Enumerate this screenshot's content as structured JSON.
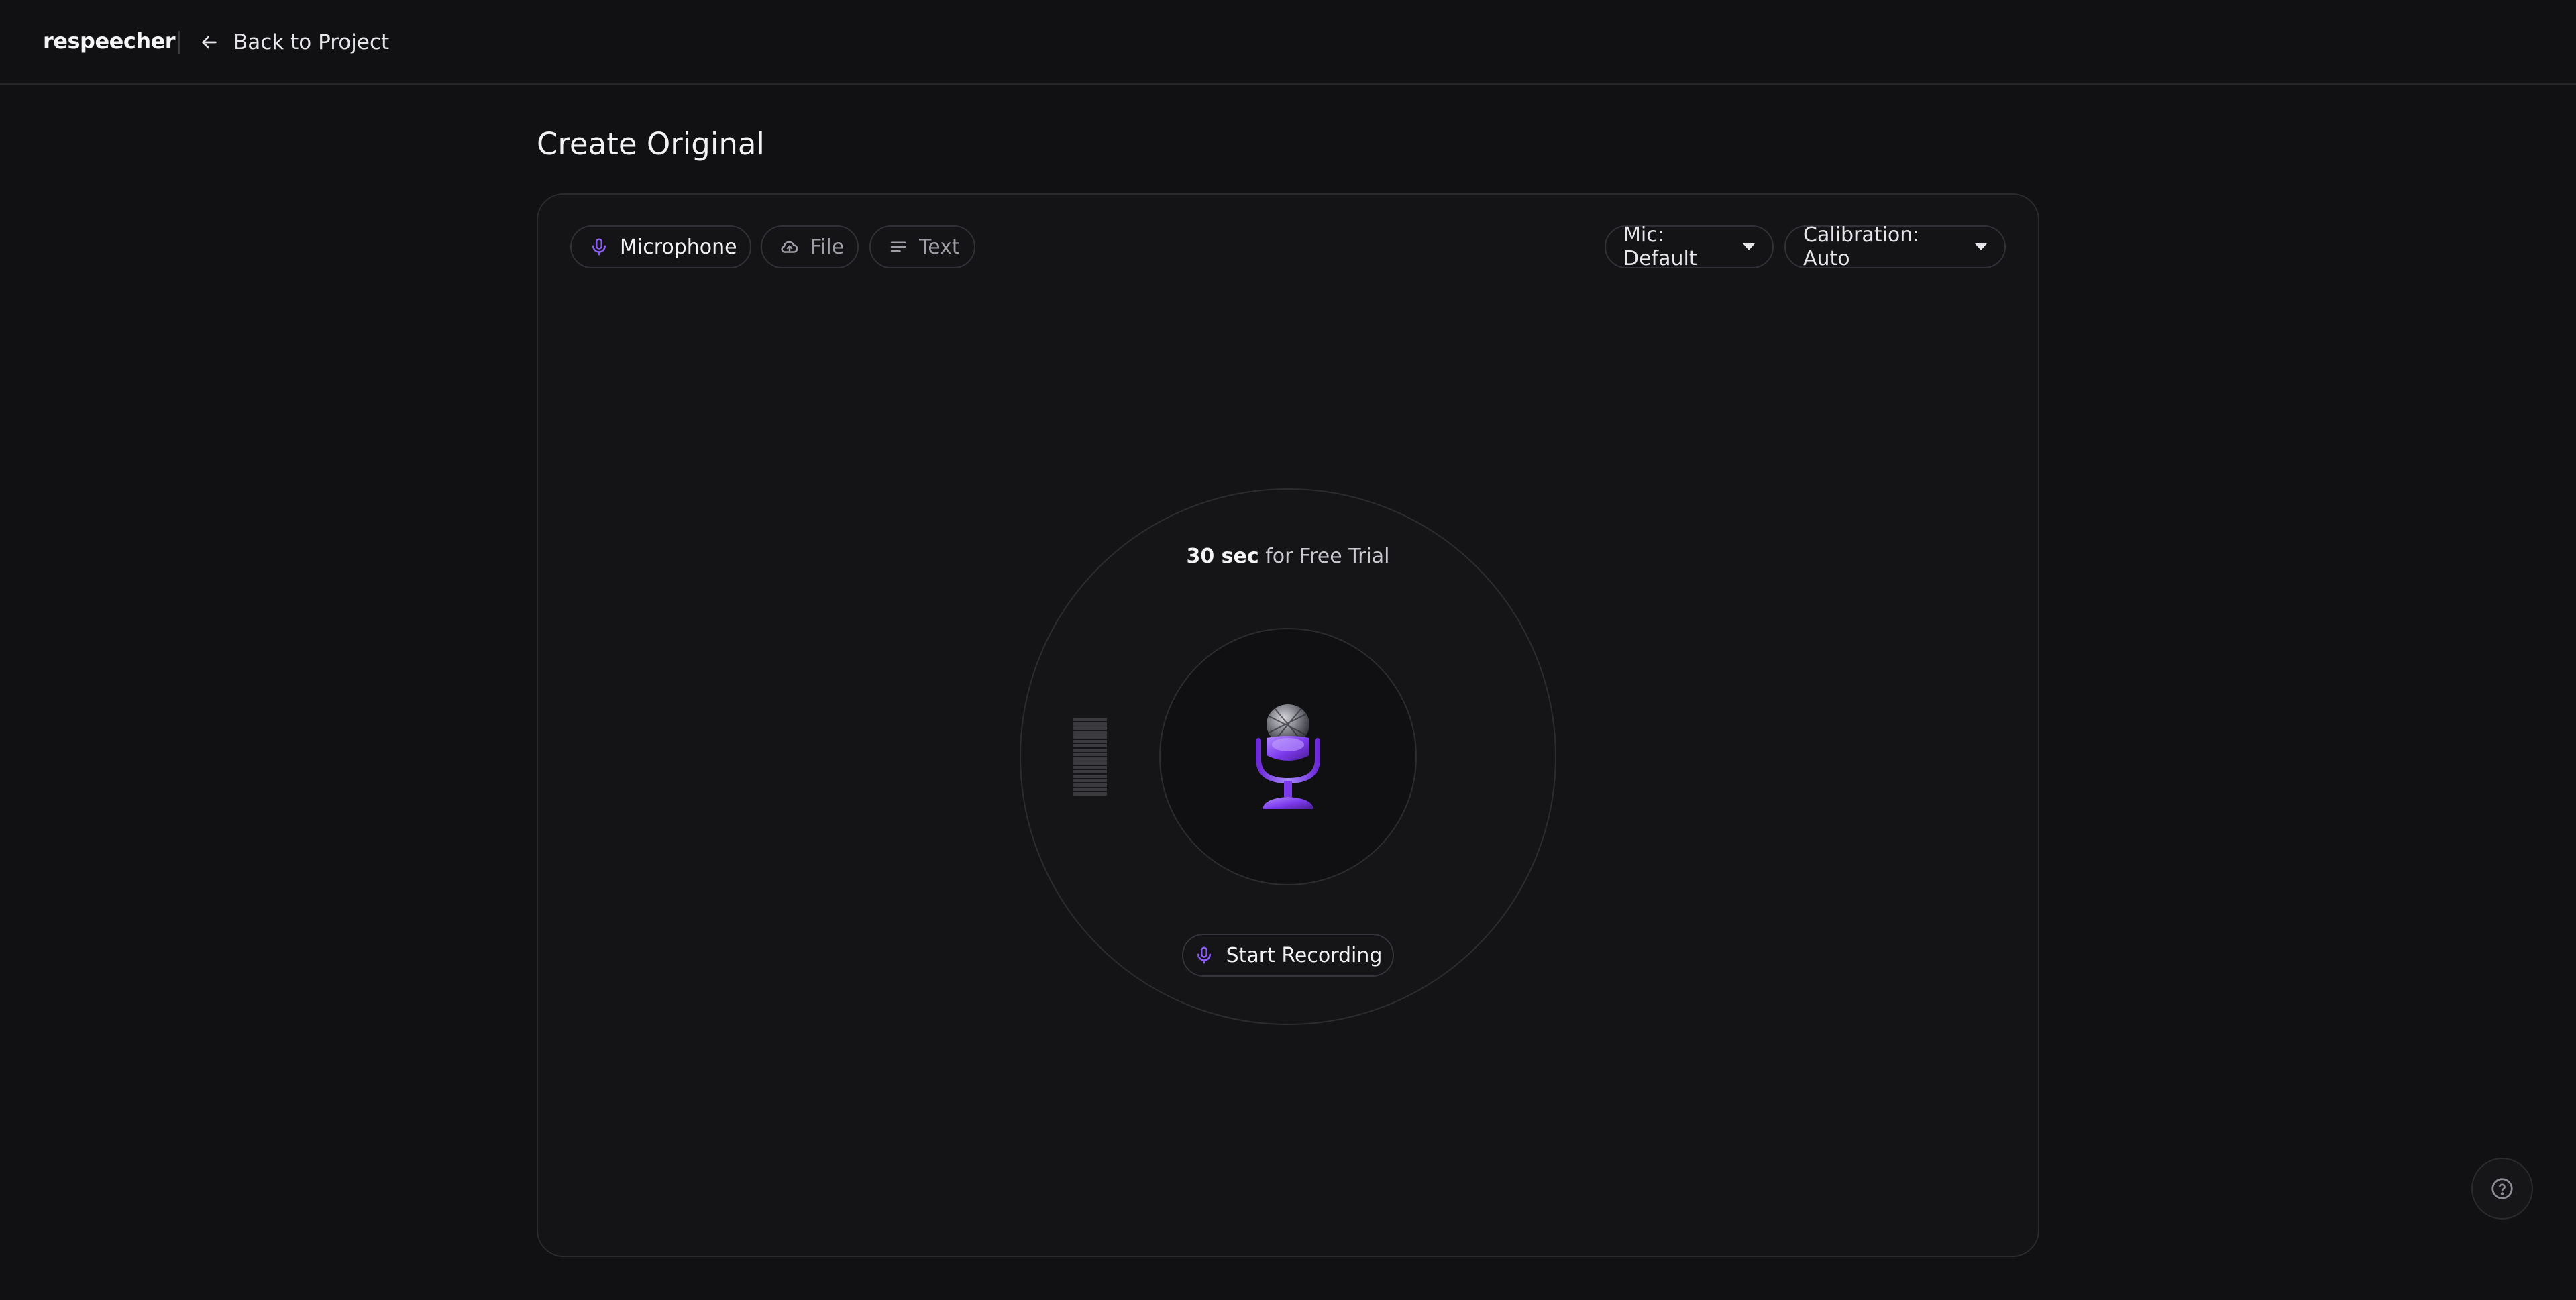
{
  "header": {
    "logo_text": "respeecher",
    "back_label": "Back to Project"
  },
  "page": {
    "title": "Create Original"
  },
  "source_tabs": [
    {
      "label": "Microphone",
      "icon": "microphone-icon",
      "active": true
    },
    {
      "label": "File",
      "icon": "cloud-upload-icon",
      "active": false
    },
    {
      "label": "Text",
      "icon": "text-lines-icon",
      "active": false
    }
  ],
  "controls": {
    "mic_select": "Mic: Default",
    "calibration_select": "Calibration: Auto"
  },
  "recorder": {
    "trial_bold": "30 sec",
    "trial_rest": " for Free Trial",
    "start_label": "Start Recording",
    "level_bars": 18
  },
  "colors": {
    "background": "#111113",
    "card": "#141416",
    "accent": "#8b5cf6",
    "border": "#2a2a2f"
  }
}
